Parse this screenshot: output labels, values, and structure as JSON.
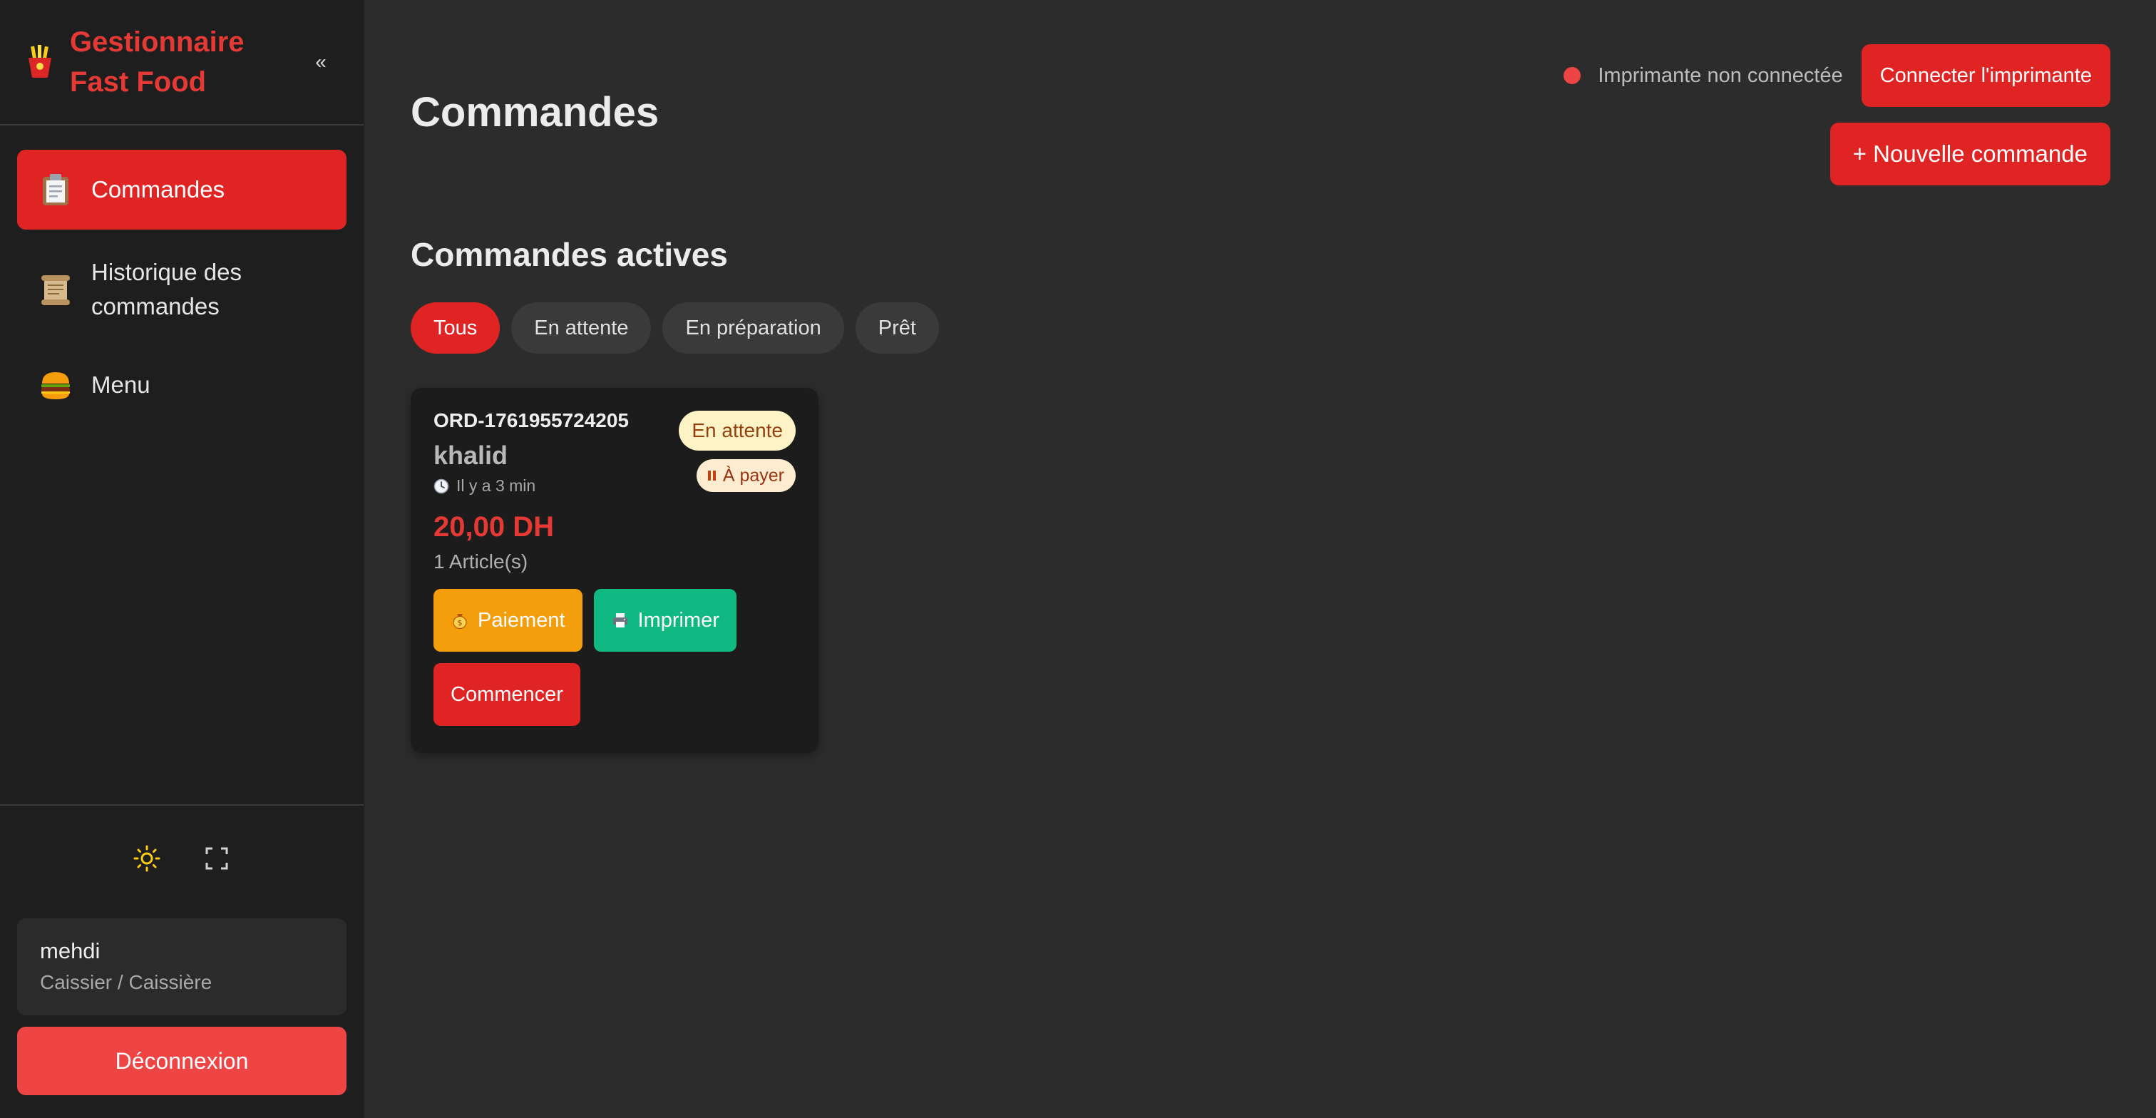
{
  "sidebar": {
    "brand_line1": "Gestionnaire",
    "brand_line2": "Fast Food",
    "collapse_label": "«",
    "items": [
      {
        "label": "Commandes",
        "icon": "clipboard-icon",
        "active": true
      },
      {
        "label": "Historique des commandes",
        "icon": "scroll-icon",
        "active": false
      },
      {
        "label": "Menu",
        "icon": "burger-icon",
        "active": false
      }
    ],
    "user": {
      "name": "mehdi",
      "role": "Caissier / Caissière"
    },
    "logout_label": "Déconnexion"
  },
  "header": {
    "title": "Commandes",
    "printer_status": "Imprimante non connectée",
    "connect_label": "Connecter l'imprimante",
    "new_order_label": "+ Nouvelle commande"
  },
  "orders": {
    "section_title": "Commandes actives",
    "filters": [
      "Tous",
      "En attente",
      "En préparation",
      "Prêt"
    ],
    "active_filter": "Tous",
    "card": {
      "id": "ORD-1761955724205",
      "customer": "khalid",
      "time": "Il y a 3 min",
      "status": "En attente",
      "payment_status": "À payer",
      "total": "20,00 DH",
      "items": "1 Article(s)",
      "pay_label": "Paiement",
      "print_label": "Imprimer",
      "start_label": "Commencer"
    }
  },
  "colors": {
    "accent": "#e02424",
    "background": "#2c2c2c",
    "sidebar": "#1e1e1e",
    "payment": "#f59e0b",
    "print": "#10b981",
    "logout": "#ef4444"
  }
}
